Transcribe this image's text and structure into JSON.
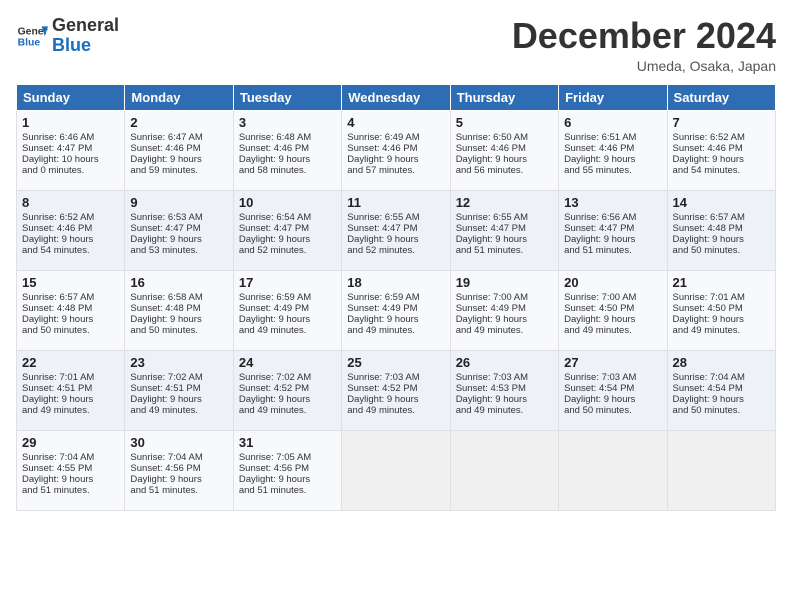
{
  "logo": {
    "line1": "General",
    "line2": "Blue"
  },
  "title": "December 2024",
  "subtitle": "Umeda, Osaka, Japan",
  "headers": [
    "Sunday",
    "Monday",
    "Tuesday",
    "Wednesday",
    "Thursday",
    "Friday",
    "Saturday"
  ],
  "weeks": [
    [
      {
        "day": "1",
        "lines": [
          "Sunrise: 6:46 AM",
          "Sunset: 4:47 PM",
          "Daylight: 10 hours",
          "and 0 minutes."
        ]
      },
      {
        "day": "2",
        "lines": [
          "Sunrise: 6:47 AM",
          "Sunset: 4:46 PM",
          "Daylight: 9 hours",
          "and 59 minutes."
        ]
      },
      {
        "day": "3",
        "lines": [
          "Sunrise: 6:48 AM",
          "Sunset: 4:46 PM",
          "Daylight: 9 hours",
          "and 58 minutes."
        ]
      },
      {
        "day": "4",
        "lines": [
          "Sunrise: 6:49 AM",
          "Sunset: 4:46 PM",
          "Daylight: 9 hours",
          "and 57 minutes."
        ]
      },
      {
        "day": "5",
        "lines": [
          "Sunrise: 6:50 AM",
          "Sunset: 4:46 PM",
          "Daylight: 9 hours",
          "and 56 minutes."
        ]
      },
      {
        "day": "6",
        "lines": [
          "Sunrise: 6:51 AM",
          "Sunset: 4:46 PM",
          "Daylight: 9 hours",
          "and 55 minutes."
        ]
      },
      {
        "day": "7",
        "lines": [
          "Sunrise: 6:52 AM",
          "Sunset: 4:46 PM",
          "Daylight: 9 hours",
          "and 54 minutes."
        ]
      }
    ],
    [
      {
        "day": "8",
        "lines": [
          "Sunrise: 6:52 AM",
          "Sunset: 4:46 PM",
          "Daylight: 9 hours",
          "and 54 minutes."
        ]
      },
      {
        "day": "9",
        "lines": [
          "Sunrise: 6:53 AM",
          "Sunset: 4:47 PM",
          "Daylight: 9 hours",
          "and 53 minutes."
        ]
      },
      {
        "day": "10",
        "lines": [
          "Sunrise: 6:54 AM",
          "Sunset: 4:47 PM",
          "Daylight: 9 hours",
          "and 52 minutes."
        ]
      },
      {
        "day": "11",
        "lines": [
          "Sunrise: 6:55 AM",
          "Sunset: 4:47 PM",
          "Daylight: 9 hours",
          "and 52 minutes."
        ]
      },
      {
        "day": "12",
        "lines": [
          "Sunrise: 6:55 AM",
          "Sunset: 4:47 PM",
          "Daylight: 9 hours",
          "and 51 minutes."
        ]
      },
      {
        "day": "13",
        "lines": [
          "Sunrise: 6:56 AM",
          "Sunset: 4:47 PM",
          "Daylight: 9 hours",
          "and 51 minutes."
        ]
      },
      {
        "day": "14",
        "lines": [
          "Sunrise: 6:57 AM",
          "Sunset: 4:48 PM",
          "Daylight: 9 hours",
          "and 50 minutes."
        ]
      }
    ],
    [
      {
        "day": "15",
        "lines": [
          "Sunrise: 6:57 AM",
          "Sunset: 4:48 PM",
          "Daylight: 9 hours",
          "and 50 minutes."
        ]
      },
      {
        "day": "16",
        "lines": [
          "Sunrise: 6:58 AM",
          "Sunset: 4:48 PM",
          "Daylight: 9 hours",
          "and 50 minutes."
        ]
      },
      {
        "day": "17",
        "lines": [
          "Sunrise: 6:59 AM",
          "Sunset: 4:49 PM",
          "Daylight: 9 hours",
          "and 49 minutes."
        ]
      },
      {
        "day": "18",
        "lines": [
          "Sunrise: 6:59 AM",
          "Sunset: 4:49 PM",
          "Daylight: 9 hours",
          "and 49 minutes."
        ]
      },
      {
        "day": "19",
        "lines": [
          "Sunrise: 7:00 AM",
          "Sunset: 4:49 PM",
          "Daylight: 9 hours",
          "and 49 minutes."
        ]
      },
      {
        "day": "20",
        "lines": [
          "Sunrise: 7:00 AM",
          "Sunset: 4:50 PM",
          "Daylight: 9 hours",
          "and 49 minutes."
        ]
      },
      {
        "day": "21",
        "lines": [
          "Sunrise: 7:01 AM",
          "Sunset: 4:50 PM",
          "Daylight: 9 hours",
          "and 49 minutes."
        ]
      }
    ],
    [
      {
        "day": "22",
        "lines": [
          "Sunrise: 7:01 AM",
          "Sunset: 4:51 PM",
          "Daylight: 9 hours",
          "and 49 minutes."
        ]
      },
      {
        "day": "23",
        "lines": [
          "Sunrise: 7:02 AM",
          "Sunset: 4:51 PM",
          "Daylight: 9 hours",
          "and 49 minutes."
        ]
      },
      {
        "day": "24",
        "lines": [
          "Sunrise: 7:02 AM",
          "Sunset: 4:52 PM",
          "Daylight: 9 hours",
          "and 49 minutes."
        ]
      },
      {
        "day": "25",
        "lines": [
          "Sunrise: 7:03 AM",
          "Sunset: 4:52 PM",
          "Daylight: 9 hours",
          "and 49 minutes."
        ]
      },
      {
        "day": "26",
        "lines": [
          "Sunrise: 7:03 AM",
          "Sunset: 4:53 PM",
          "Daylight: 9 hours",
          "and 49 minutes."
        ]
      },
      {
        "day": "27",
        "lines": [
          "Sunrise: 7:03 AM",
          "Sunset: 4:54 PM",
          "Daylight: 9 hours",
          "and 50 minutes."
        ]
      },
      {
        "day": "28",
        "lines": [
          "Sunrise: 7:04 AM",
          "Sunset: 4:54 PM",
          "Daylight: 9 hours",
          "and 50 minutes."
        ]
      }
    ],
    [
      {
        "day": "29",
        "lines": [
          "Sunrise: 7:04 AM",
          "Sunset: 4:55 PM",
          "Daylight: 9 hours",
          "and 51 minutes."
        ]
      },
      {
        "day": "30",
        "lines": [
          "Sunrise: 7:04 AM",
          "Sunset: 4:56 PM",
          "Daylight: 9 hours",
          "and 51 minutes."
        ]
      },
      {
        "day": "31",
        "lines": [
          "Sunrise: 7:05 AM",
          "Sunset: 4:56 PM",
          "Daylight: 9 hours",
          "and 51 minutes."
        ]
      },
      null,
      null,
      null,
      null
    ]
  ]
}
